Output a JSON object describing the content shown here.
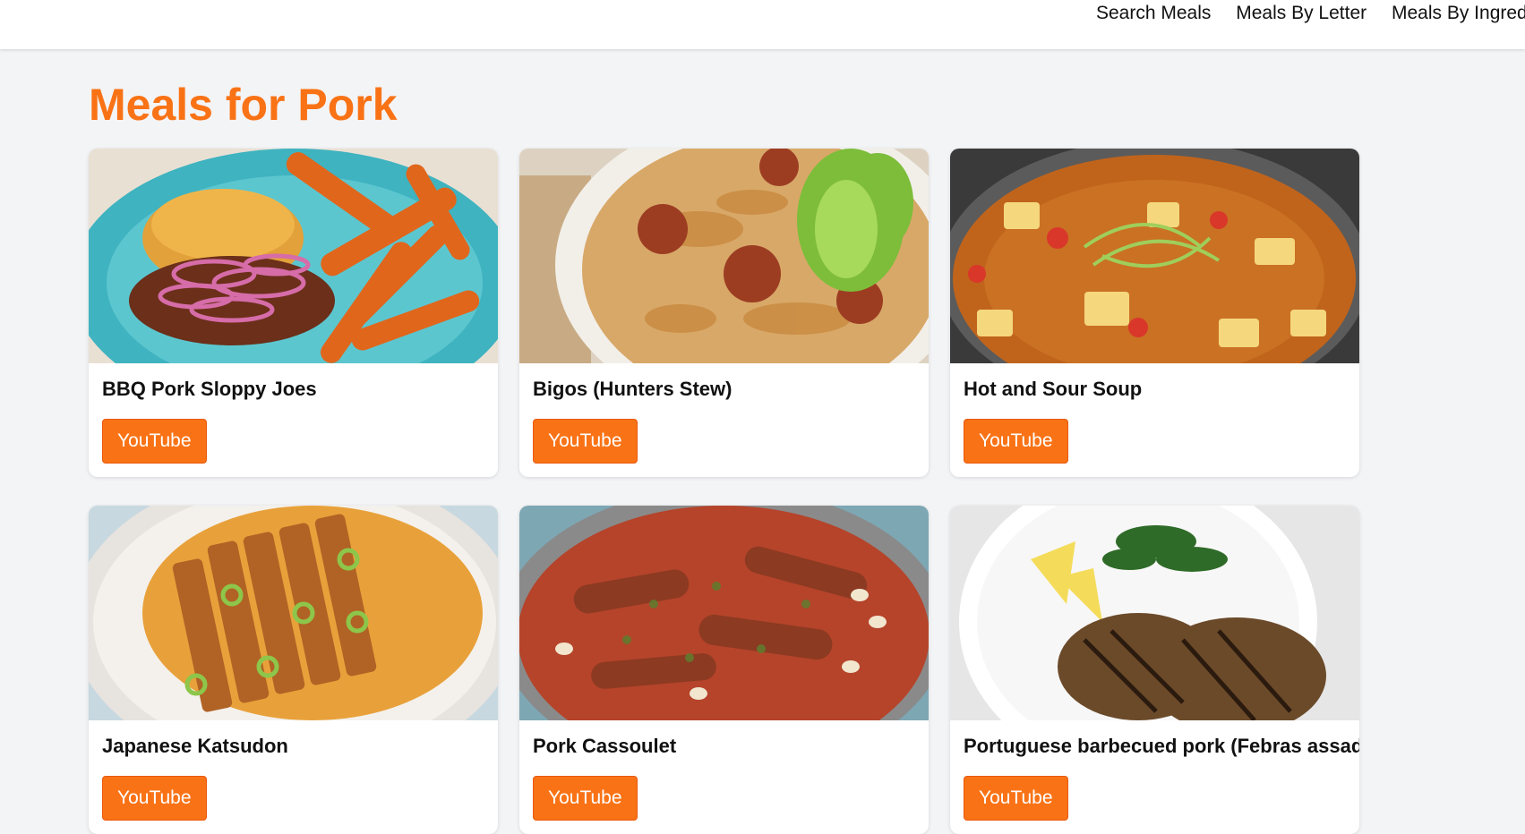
{
  "nav": {
    "items": [
      {
        "label": "Search Meals"
      },
      {
        "label": "Meals By Letter"
      },
      {
        "label": "Meals By Ingredients"
      }
    ]
  },
  "page": {
    "title": "Meals for Pork"
  },
  "meals": [
    {
      "name": "BBQ Pork Sloppy Joes",
      "button": "YouTube",
      "image": "bbq-pork-sloppy-joes-photo"
    },
    {
      "name": "Bigos (Hunters Stew)",
      "button": "YouTube",
      "image": "bigos-stew-photo"
    },
    {
      "name": "Hot and Sour Soup",
      "button": "YouTube",
      "image": "hot-and-sour-soup-photo"
    },
    {
      "name": "Japanese Katsudon",
      "button": "YouTube",
      "image": "japanese-katsudon-photo"
    },
    {
      "name": "Pork Cassoulet",
      "button": "YouTube",
      "image": "pork-cassoulet-photo"
    },
    {
      "name": "Portuguese barbecued pork (Febras assadas)",
      "button": "YouTube",
      "image": "portuguese-barbecued-pork-photo"
    }
  ],
  "colors": {
    "accent": "#f97316",
    "background": "#f3f4f6",
    "card": "#ffffff"
  }
}
